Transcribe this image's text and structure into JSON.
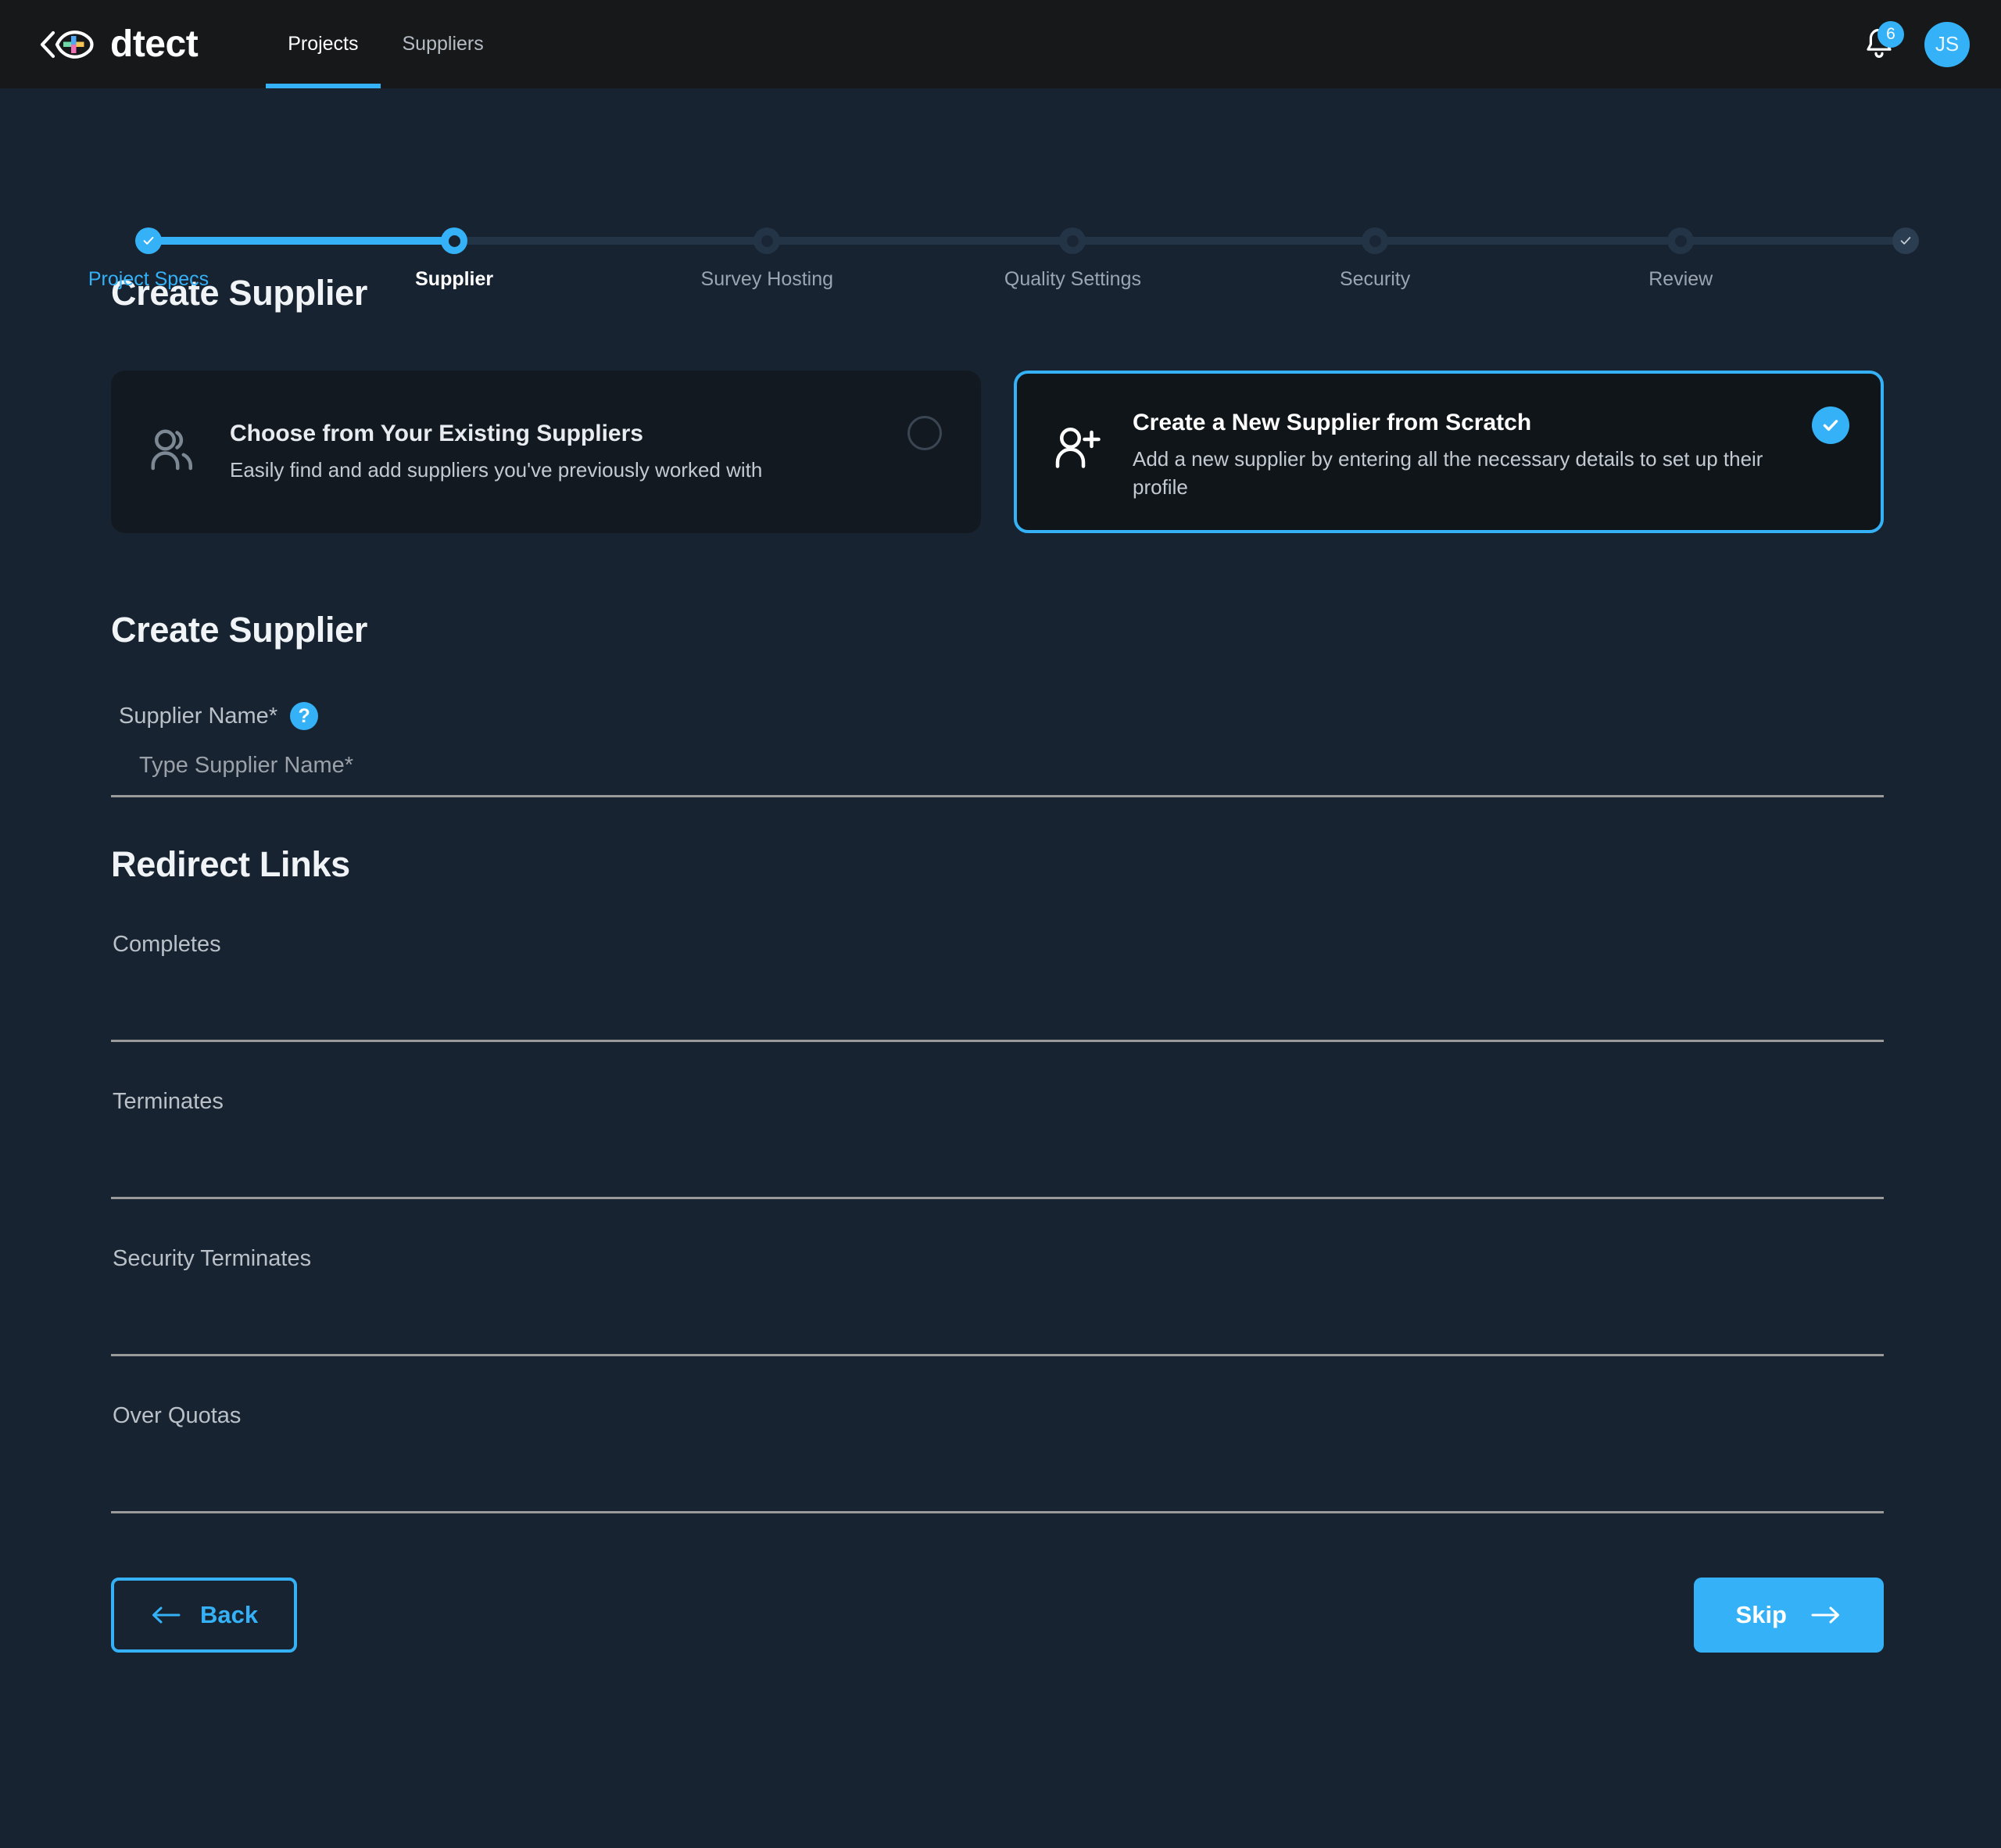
{
  "header": {
    "brand_name": "dtect",
    "logo_icon": "dtect-eye-plus-logo",
    "nav": [
      {
        "label": "Projects",
        "active": true
      },
      {
        "label": "Suppliers",
        "active": false
      }
    ],
    "notifications": {
      "icon": "bell-icon",
      "count": "6"
    },
    "avatar_initials": "JS"
  },
  "stepper": {
    "steps": [
      {
        "label": "Project Specs",
        "state": "done"
      },
      {
        "label": "Supplier",
        "state": "current"
      },
      {
        "label": "Survey Hosting",
        "state": "todo"
      },
      {
        "label": "Quality Settings",
        "state": "todo"
      },
      {
        "label": "Security",
        "state": "todo"
      },
      {
        "label": "Review",
        "state": "todo"
      },
      {
        "label": "",
        "state": "endcap"
      }
    ]
  },
  "main": {
    "title": "Create Supplier",
    "options": [
      {
        "icon": "users-group-icon",
        "title": "Choose from Your Existing Suppliers",
        "subtitle": "Easily find and add suppliers you've previously worked with",
        "selected": false
      },
      {
        "icon": "user-plus-icon",
        "title": "Create a New Supplier from Scratch",
        "subtitle": "Add a new supplier by entering all the necessary details to set up their profile",
        "selected": true
      }
    ],
    "form_title": "Create Supplier",
    "supplier_name": {
      "label": "Supplier Name*",
      "help_icon": "question-mark-icon",
      "help_glyph": "?",
      "placeholder": "Type Supplier Name*",
      "value": ""
    },
    "redirect_title": "Redirect Links",
    "redirect_links": [
      {
        "label": "Completes",
        "placeholder": "",
        "value": ""
      },
      {
        "label": "Terminates",
        "placeholder": "",
        "value": ""
      },
      {
        "label": "Security Terminates",
        "placeholder": "",
        "value": ""
      },
      {
        "label": "Over Quotas",
        "placeholder": "",
        "value": ""
      }
    ]
  },
  "footer": {
    "back_label": "Back",
    "back_icon": "arrow-left-icon",
    "skip_label": "Skip",
    "skip_icon": "arrow-right-icon"
  },
  "colors": {
    "accent": "#35b2f7",
    "page_bg": "#172330",
    "header_bg": "#16181a",
    "card_bg": "#121920",
    "selected_card_bg": "#0f1519",
    "track": "#243447",
    "input_underline": "#9a9a9a"
  }
}
